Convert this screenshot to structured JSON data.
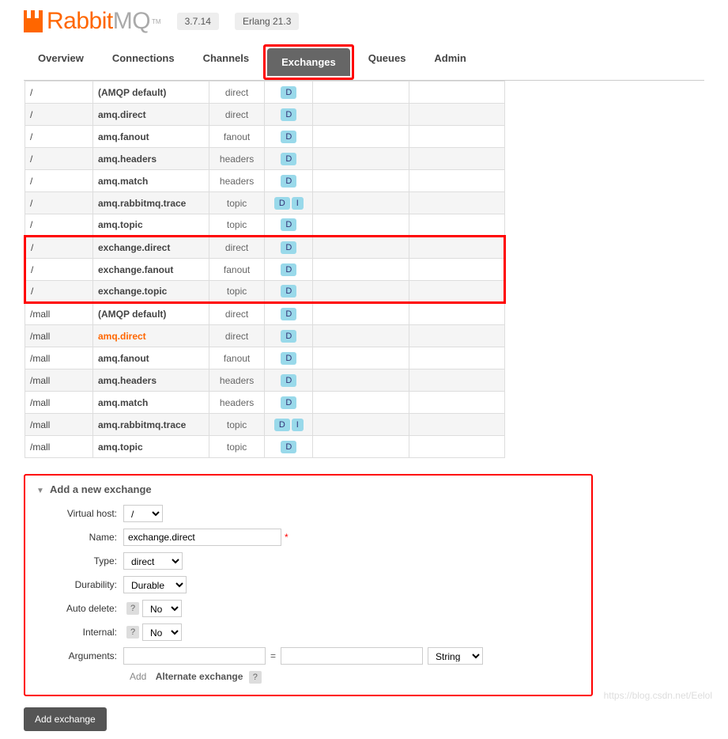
{
  "logo": {
    "brand": "Rabbit",
    "suffix": "MQ",
    "tm": "TM"
  },
  "versions": {
    "app": "3.7.14",
    "erlang": "Erlang 21.3"
  },
  "tabs": [
    "Overview",
    "Connections",
    "Channels",
    "Exchanges",
    "Queues",
    "Admin"
  ],
  "activeTab": "Exchanges",
  "exchanges": [
    {
      "vhost": "/",
      "name": "(AMQP default)",
      "type": "direct",
      "features": [
        "D"
      ],
      "alt": false,
      "hl": false
    },
    {
      "vhost": "/",
      "name": "amq.direct",
      "type": "direct",
      "features": [
        "D"
      ],
      "alt": true,
      "hl": false
    },
    {
      "vhost": "/",
      "name": "amq.fanout",
      "type": "fanout",
      "features": [
        "D"
      ],
      "alt": false,
      "hl": false
    },
    {
      "vhost": "/",
      "name": "amq.headers",
      "type": "headers",
      "features": [
        "D"
      ],
      "alt": true,
      "hl": false
    },
    {
      "vhost": "/",
      "name": "amq.match",
      "type": "headers",
      "features": [
        "D"
      ],
      "alt": false,
      "hl": false
    },
    {
      "vhost": "/",
      "name": "amq.rabbitmq.trace",
      "type": "topic",
      "features": [
        "D",
        "I"
      ],
      "alt": true,
      "hl": false
    },
    {
      "vhost": "/",
      "name": "amq.topic",
      "type": "topic",
      "features": [
        "D"
      ],
      "alt": false,
      "hl": false
    },
    {
      "vhost": "/",
      "name": "exchange.direct",
      "type": "direct",
      "features": [
        "D"
      ],
      "alt": true,
      "hl": false,
      "boxtop": true
    },
    {
      "vhost": "/",
      "name": "exchange.fanout",
      "type": "fanout",
      "features": [
        "D"
      ],
      "alt": false,
      "hl": false
    },
    {
      "vhost": "/",
      "name": "exchange.topic",
      "type": "topic",
      "features": [
        "D"
      ],
      "alt": true,
      "hl": false,
      "boxbottom": true
    },
    {
      "vhost": "/mall",
      "name": "(AMQP default)",
      "type": "direct",
      "features": [
        "D"
      ],
      "alt": false,
      "hl": false
    },
    {
      "vhost": "/mall",
      "name": "amq.direct",
      "type": "direct",
      "features": [
        "D"
      ],
      "alt": true,
      "hl": true
    },
    {
      "vhost": "/mall",
      "name": "amq.fanout",
      "type": "fanout",
      "features": [
        "D"
      ],
      "alt": false,
      "hl": false
    },
    {
      "vhost": "/mall",
      "name": "amq.headers",
      "type": "headers",
      "features": [
        "D"
      ],
      "alt": true,
      "hl": false
    },
    {
      "vhost": "/mall",
      "name": "amq.match",
      "type": "headers",
      "features": [
        "D"
      ],
      "alt": false,
      "hl": false
    },
    {
      "vhost": "/mall",
      "name": "amq.rabbitmq.trace",
      "type": "topic",
      "features": [
        "D",
        "I"
      ],
      "alt": true,
      "hl": false
    },
    {
      "vhost": "/mall",
      "name": "amq.topic",
      "type": "topic",
      "features": [
        "D"
      ],
      "alt": false,
      "hl": false
    }
  ],
  "form": {
    "title": "Add a new exchange",
    "labels": {
      "vhost": "Virtual host:",
      "name": "Name:",
      "type": "Type:",
      "durability": "Durability:",
      "autodelete": "Auto delete:",
      "internal": "Internal:",
      "arguments": "Arguments:"
    },
    "vhost_value": "/",
    "name_value": "exchange.direct",
    "type_value": "direct",
    "durability_value": "Durable",
    "autodelete_value": "No",
    "internal_value": "No",
    "arg_key": "",
    "arg_val": "",
    "arg_type": "String",
    "add_label": "Add",
    "alt_exchange_label": "Alternate exchange",
    "help": "?",
    "equals": "="
  },
  "submit_label": "Add exchange",
  "watermark": "https://blog.csdn.net/Eelol"
}
